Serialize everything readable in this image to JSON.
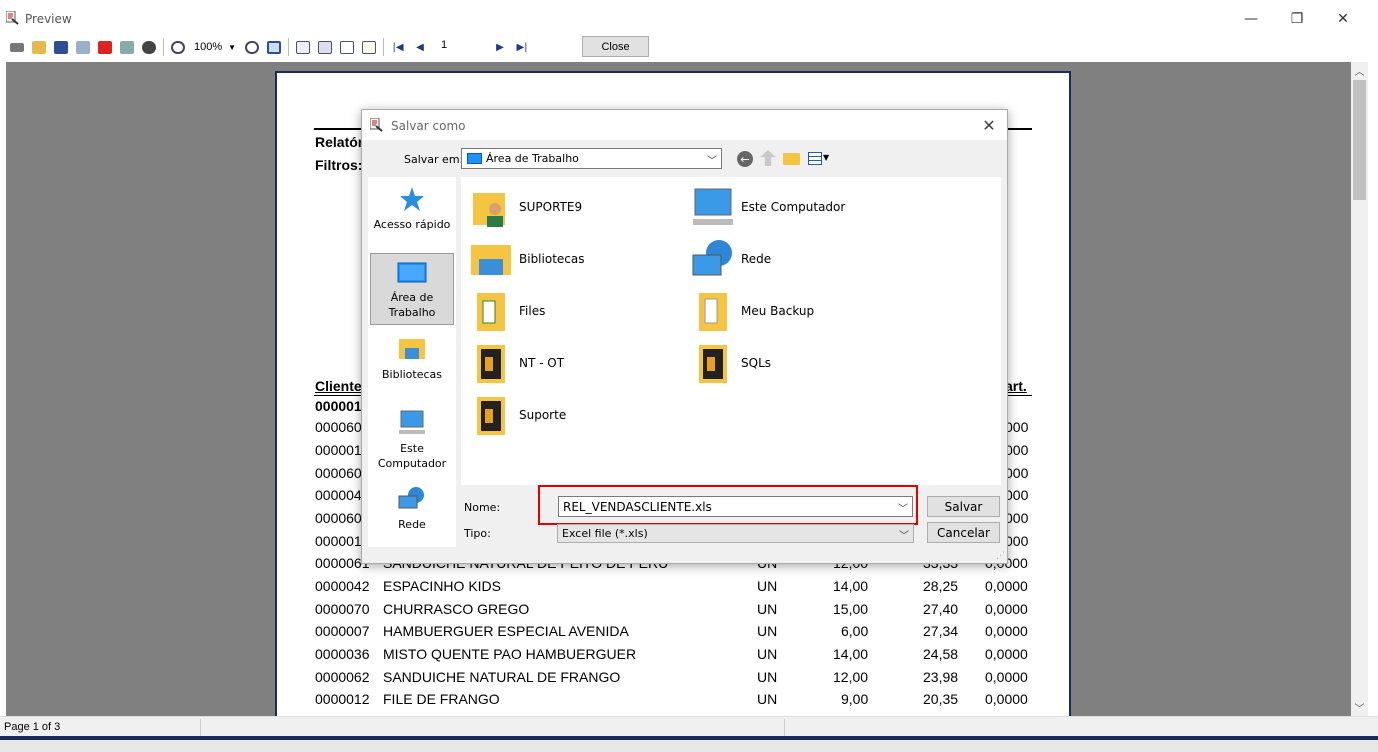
{
  "window": {
    "title": "Preview",
    "minimize": "—",
    "restore": "❐",
    "close": "✕"
  },
  "toolbar": {
    "zoom": "100%",
    "page": "1",
    "close_label": "Close"
  },
  "report": {
    "title_fragment": "Relatór",
    "filters_fragment": "Filtros:",
    "header_cliente": "Cliente",
    "header_part": "art.",
    "first_code": "000001",
    "partial_rows": [
      {
        "code": "000060",
        "tail": "000"
      },
      {
        "code": "000001",
        "tail": "000"
      },
      {
        "code": "000060",
        "tail": "000"
      },
      {
        "code": "000004",
        "tail": "000"
      },
      {
        "code": "000060",
        "tail": "000"
      },
      {
        "code": "000001",
        "tail": "000"
      }
    ],
    "hidden_row": {
      "code": "0000061",
      "name": "SANDUICHE NATURAL DE PEITO DE PERU",
      "unit": "UN",
      "qty": "12,00",
      "value": "33,33",
      "part": "0,0000"
    },
    "rows": [
      {
        "code": "0000042",
        "name": "ESPACINHO KIDS",
        "unit": "UN",
        "qty": "14,00",
        "value": "28,25",
        "part": "0,0000"
      },
      {
        "code": "0000070",
        "name": "CHURRASCO GREGO",
        "unit": "UN",
        "qty": "15,00",
        "value": "27,40",
        "part": "0,0000"
      },
      {
        "code": "0000007",
        "name": "HAMBUERGUER ESPECIAL AVENIDA",
        "unit": "UN",
        "qty": "6,00",
        "value": "27,34",
        "part": "0,0000"
      },
      {
        "code": "0000036",
        "name": "MISTO QUENTE PAO HAMBUERGUER",
        "unit": "UN",
        "qty": "14,00",
        "value": "24,58",
        "part": "0,0000"
      },
      {
        "code": "0000062",
        "name": "SANDUICHE NATURAL DE FRANGO",
        "unit": "UN",
        "qty": "12,00",
        "value": "23,98",
        "part": "0,0000"
      },
      {
        "code": "0000012",
        "name": "FILE DE FRANGO",
        "unit": "UN",
        "qty": "9,00",
        "value": "20,35",
        "part": "0,0000"
      }
    ]
  },
  "status": {
    "page_text": "Page 1 of 3"
  },
  "dialog": {
    "title": "Salvar como",
    "save_in_label": "Salvar em:",
    "save_in_value": "Área de Trabalho",
    "places": [
      {
        "label": "Acesso rápido"
      },
      {
        "label": "Área de Trabalho"
      },
      {
        "label": "Bibliotecas"
      },
      {
        "label": "Este Computador"
      },
      {
        "label": "Rede"
      }
    ],
    "files": [
      {
        "name": "SUPORTE9"
      },
      {
        "name": "Este Computador"
      },
      {
        "name": "Bibliotecas"
      },
      {
        "name": "Rede"
      },
      {
        "name": "Files"
      },
      {
        "name": "Meu Backup"
      },
      {
        "name": "NT - OT"
      },
      {
        "name": "SQLs"
      },
      {
        "name": "Suporte"
      }
    ],
    "name_label": "Nome:",
    "name_value": "REL_VENDASCLIENTE.xls",
    "type_label": "Tipo:",
    "type_value": "Excel file (*.xls)",
    "save_button": "Salvar",
    "cancel_button": "Cancelar"
  },
  "colors": {
    "highlight": "#e00000",
    "preview_bg": "#808080",
    "page_border": "#1a2a5a"
  }
}
